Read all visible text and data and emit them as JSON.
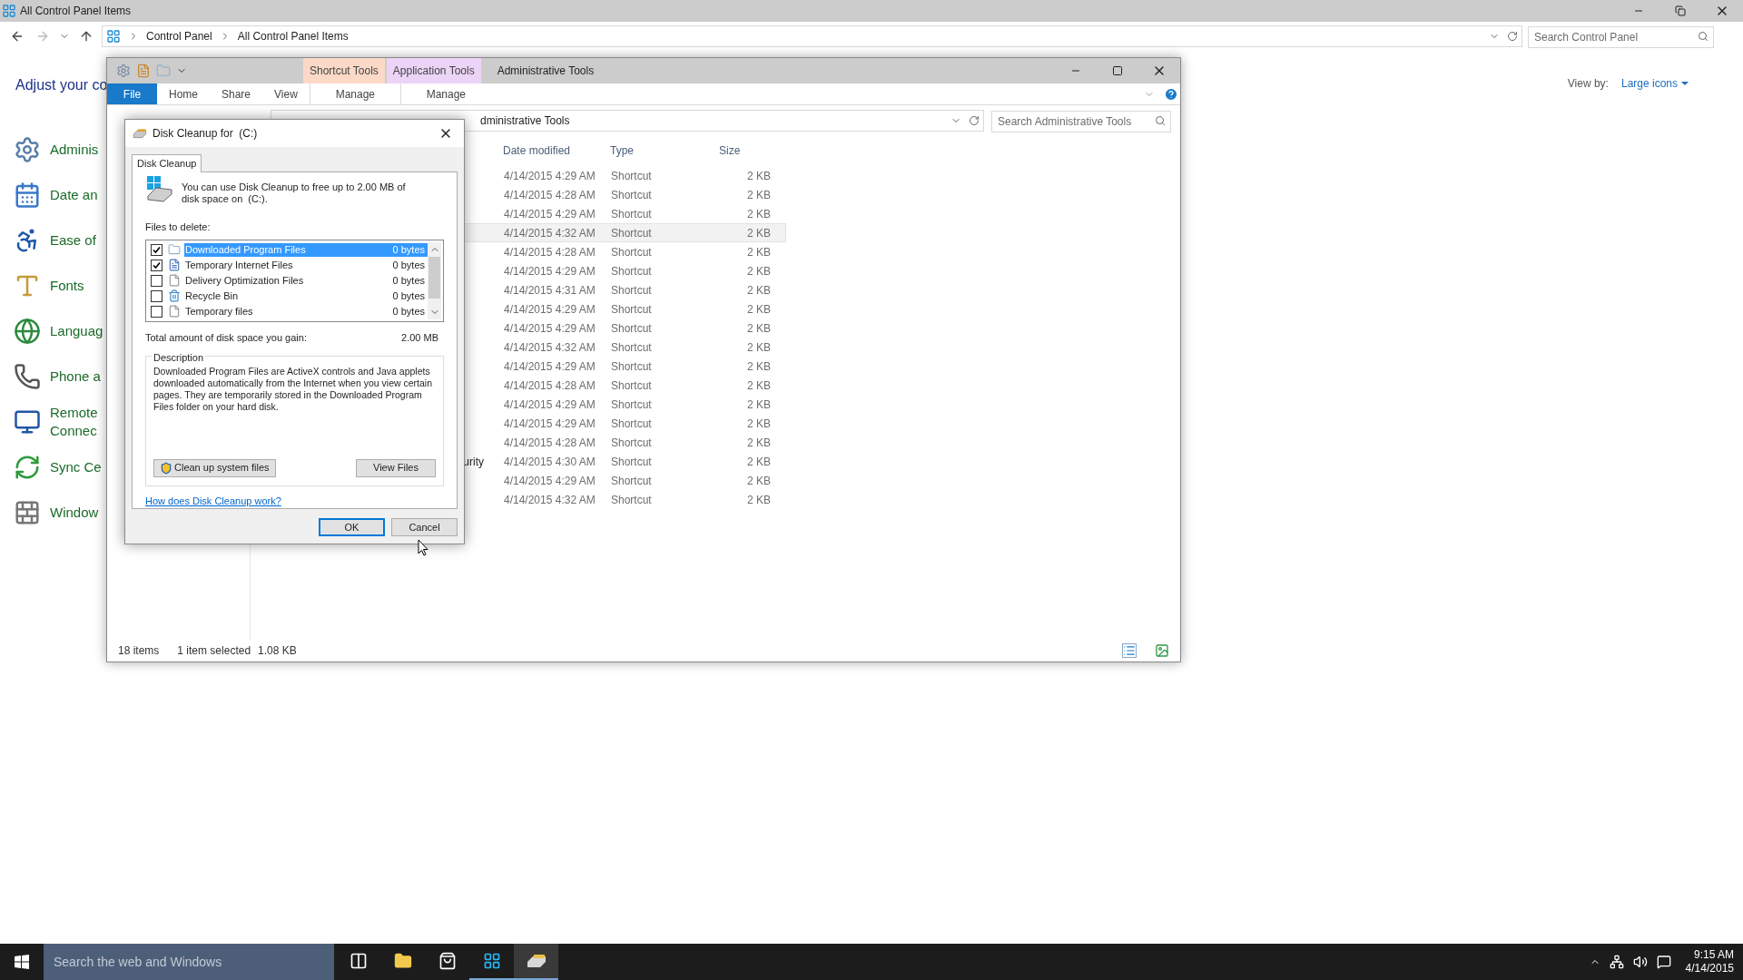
{
  "control_panel": {
    "title": "All Control Panel Items",
    "breadcrumb": [
      "Control Panel",
      "All Control Panel Items"
    ],
    "search": {
      "placeholder": "Search Control Panel"
    },
    "heading": "Adjust your co",
    "view_by": {
      "label": "View by:",
      "value": "Large icons"
    },
    "items": [
      {
        "lines": [
          "Adminis"
        ]
      },
      {
        "lines": [
          "Date an"
        ]
      },
      {
        "lines": [
          "Ease of"
        ]
      },
      {
        "lines": [
          "Fonts"
        ]
      },
      {
        "lines": [
          "Languag"
        ]
      },
      {
        "lines": [
          "Phone a"
        ]
      },
      {
        "lines": [
          "Remote",
          "Connec"
        ]
      },
      {
        "lines": [
          "Sync Ce"
        ]
      },
      {
        "lines": [
          "Window"
        ]
      }
    ]
  },
  "explorer": {
    "title": "Administrative Tools",
    "context_tabs": [
      {
        "label": "Shortcut Tools",
        "color": "#fbd9c6"
      },
      {
        "label": "Application Tools",
        "color": "#ecd4f7"
      }
    ],
    "ribbon_tabs": [
      {
        "label": "File",
        "kind": "menu"
      },
      {
        "label": "Home",
        "kind": "tab"
      },
      {
        "label": "Share",
        "kind": "tab"
      },
      {
        "label": "View",
        "kind": "tab"
      },
      {
        "label": "Manage",
        "kind": "context"
      },
      {
        "label": "Manage",
        "kind": "context"
      }
    ],
    "address": "dministrative Tools",
    "search": {
      "placeholder": "Search Administrative Tools"
    },
    "columns": [
      "Date modified",
      "Type",
      "Size"
    ],
    "rows": [
      {
        "date": "4/14/2015 4:29 AM",
        "type": "Shortcut",
        "size": "2 KB",
        "selected": false
      },
      {
        "date": "4/14/2015 4:28 AM",
        "type": "Shortcut",
        "size": "2 KB",
        "selected": false
      },
      {
        "date": "4/14/2015 4:29 AM",
        "type": "Shortcut",
        "size": "2 KB",
        "selected": false
      },
      {
        "date": "4/14/2015 4:32 AM",
        "type": "Shortcut",
        "size": "2 KB",
        "selected": true
      },
      {
        "date": "4/14/2015 4:28 AM",
        "type": "Shortcut",
        "size": "2 KB",
        "selected": false
      },
      {
        "date": "4/14/2015 4:29 AM",
        "type": "Shortcut",
        "size": "2 KB",
        "selected": false
      },
      {
        "date": "4/14/2015 4:31 AM",
        "type": "Shortcut",
        "size": "2 KB",
        "selected": false
      },
      {
        "date": "4/14/2015 4:29 AM",
        "type": "Shortcut",
        "size": "2 KB",
        "selected": false
      },
      {
        "date": "4/14/2015 4:29 AM",
        "type": "Shortcut",
        "size": "2 KB",
        "selected": false
      },
      {
        "date": "4/14/2015 4:32 AM",
        "type": "Shortcut",
        "size": "2 KB",
        "selected": false
      },
      {
        "date": "4/14/2015 4:29 AM",
        "type": "Shortcut",
        "size": "2 KB",
        "selected": false
      },
      {
        "date": "4/14/2015 4:28 AM",
        "type": "Shortcut",
        "size": "2 KB",
        "selected": false
      },
      {
        "date": "4/14/2015 4:29 AM",
        "type": "Shortcut",
        "size": "2 KB",
        "selected": false
      },
      {
        "date": "4/14/2015 4:29 AM",
        "type": "Shortcut",
        "size": "2 KB",
        "selected": false
      },
      {
        "date": "4/14/2015 4:28 AM",
        "type": "Shortcut",
        "size": "2 KB",
        "selected": false
      },
      {
        "name": "urity",
        "date": "4/14/2015 4:30 AM",
        "type": "Shortcut",
        "size": "2 KB",
        "selected": false
      },
      {
        "date": "4/14/2015 4:29 AM",
        "type": "Shortcut",
        "size": "2 KB",
        "selected": false
      },
      {
        "date": "4/14/2015 4:32 AM",
        "type": "Shortcut",
        "size": "2 KB",
        "selected": false
      }
    ],
    "status": {
      "count": "18 items",
      "selection": "1 item selected",
      "size": "1.08 KB"
    }
  },
  "dialog": {
    "title": "Disk Cleanup for  (C:)",
    "tabs": [
      {
        "label": "Disk Cleanup",
        "selected": true
      }
    ],
    "intro": "You can use Disk Cleanup to free up to 2.00 MB of disk space on  (C:).",
    "files_label": "Files to delete:",
    "files": [
      {
        "name": "Downloaded Program Files",
        "size": "0 bytes",
        "checked": true,
        "selected": true
      },
      {
        "name": "Temporary Internet Files",
        "size": "0 bytes",
        "checked": true,
        "selected": false
      },
      {
        "name": "Delivery Optimization Files",
        "size": "0 bytes",
        "checked": false,
        "selected": false
      },
      {
        "name": "Recycle Bin",
        "size": "0 bytes",
        "checked": false,
        "selected": false
      },
      {
        "name": "Temporary files",
        "size": "0 bytes",
        "checked": false,
        "selected": false
      }
    ],
    "total_label": "Total amount of disk space you gain:",
    "total": "2.00 MB",
    "description_title": "Description",
    "description": "Downloaded Program Files are ActiveX controls and Java applets downloaded automatically from the Internet when you view certain pages. They are temporarily stored in the Downloaded Program Files folder on your hard disk.",
    "cleanup_button": "Clean up system files",
    "view_button": "View Files",
    "help_link": "How does Disk Cleanup work?",
    "ok": "OK",
    "cancel": "Cancel"
  },
  "taskbar": {
    "search": {
      "placeholder": "Search the web and Windows"
    },
    "apps": [
      {
        "open": false,
        "active": false
      },
      {
        "open": false,
        "active": false
      },
      {
        "open": false,
        "active": false
      },
      {
        "open": true,
        "active": false
      },
      {
        "open": true,
        "active": true
      }
    ],
    "clock": {
      "time": "9:15 AM",
      "date": "4/14/2015"
    }
  }
}
